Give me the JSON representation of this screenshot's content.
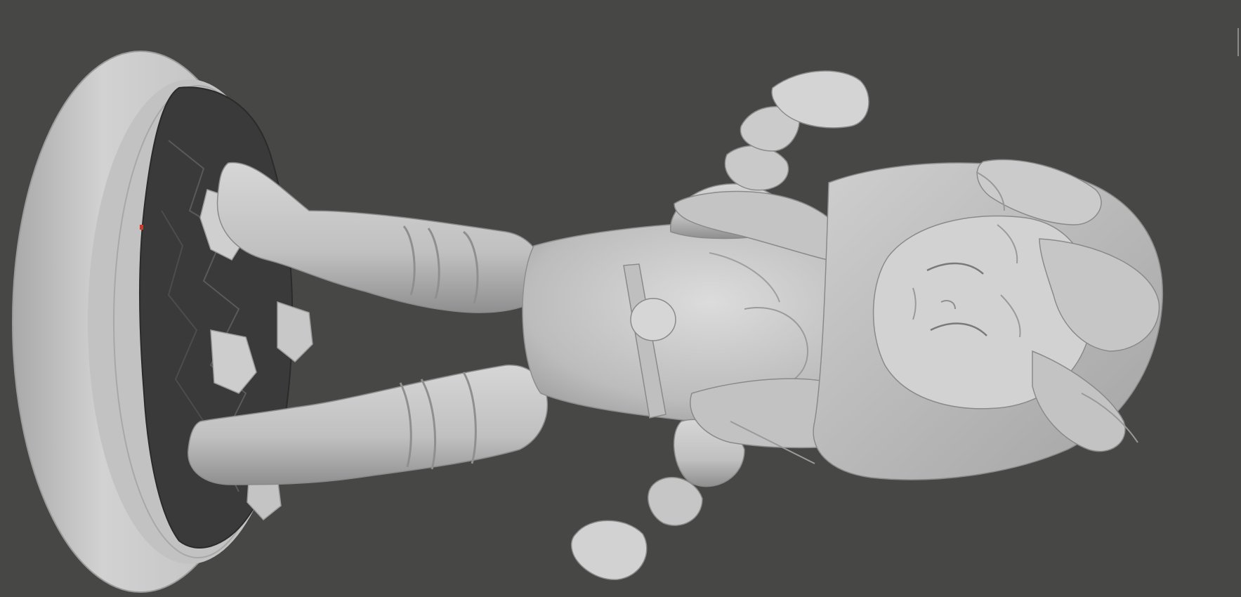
{
  "viewport": {
    "background_color": "#474746",
    "model_color": "#c8c8c8",
    "base_top_color": "#3a3a3a",
    "selection_marker_color": "#c83a2a"
  }
}
